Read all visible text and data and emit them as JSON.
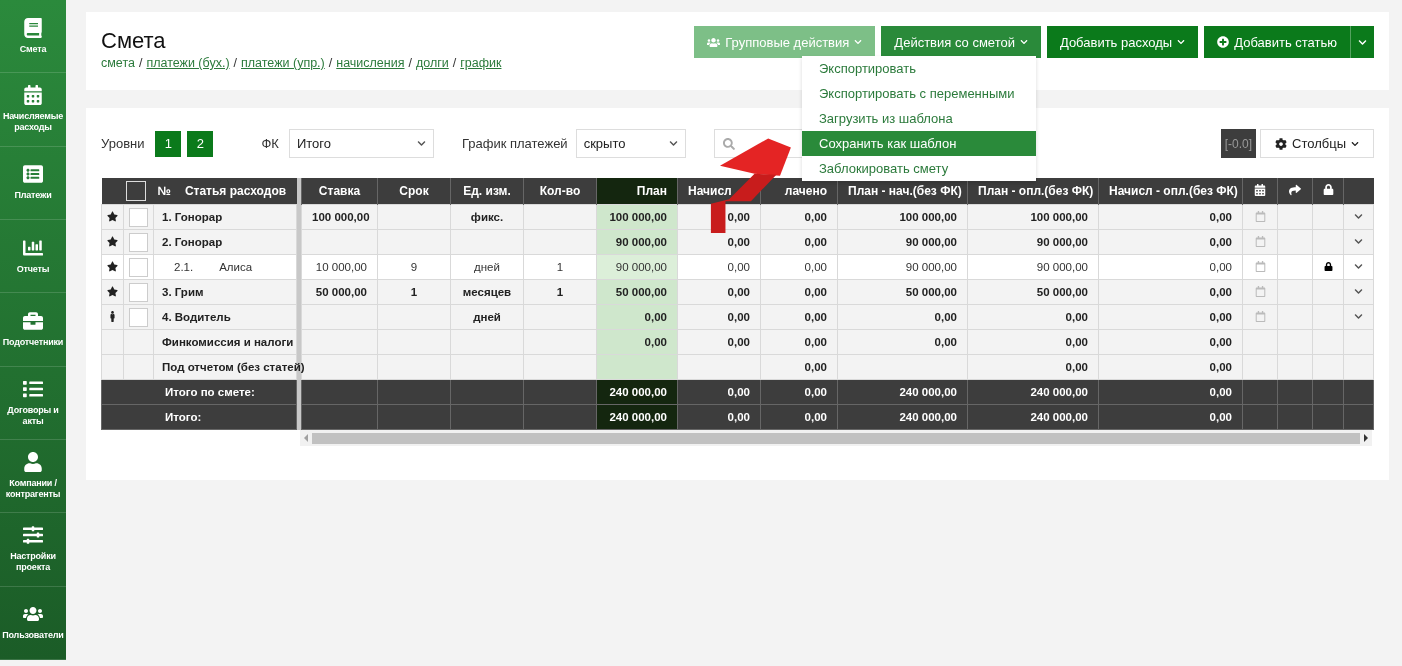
{
  "sidebar": {
    "items": [
      {
        "label": "Смета"
      },
      {
        "label": "Начисляемые расходы"
      },
      {
        "label": "Платежи"
      },
      {
        "label": "Отчеты"
      },
      {
        "label": "Подотчетники"
      },
      {
        "label": "Договоры и акты"
      },
      {
        "label": "Компании / контрагенты"
      },
      {
        "label": "Настройки проекта"
      },
      {
        "label": "Пользователи"
      }
    ]
  },
  "header": {
    "title": "Смета",
    "breadcrumbs": [
      {
        "label": "смета",
        "link": false
      },
      {
        "label": "платежи (бух.)",
        "link": true
      },
      {
        "label": "платежи (упр.)",
        "link": true
      },
      {
        "label": "начисления",
        "link": true
      },
      {
        "label": "долги",
        "link": true
      },
      {
        "label": "график",
        "link": true
      }
    ],
    "separator": "/"
  },
  "toolbar": [
    {
      "label": "Групповые действия",
      "kind": "group",
      "disabled": true
    },
    {
      "label": "Действия со сметой",
      "kind": "menu",
      "expanded": true
    },
    {
      "label": "Добавить расходы",
      "kind": "menu",
      "expanded": false
    },
    {
      "label": "Добавить статью",
      "kind": "split"
    }
  ],
  "menu": {
    "items": [
      {
        "label": "Экспортировать",
        "selected": false
      },
      {
        "label": "Экспортировать с переменными",
        "selected": false
      },
      {
        "label": "Загрузить из шаблона",
        "selected": false
      },
      {
        "label": "Сохранить как шаблон",
        "selected": true
      },
      {
        "label": "Заблокировать смету",
        "selected": false
      }
    ]
  },
  "filters": {
    "levels_label": "Уровни",
    "levels": [
      {
        "label": "1"
      },
      {
        "label": "2"
      }
    ],
    "fk": {
      "label": "ФК",
      "value": "Итого"
    },
    "schedule": {
      "label": "График платежей",
      "value": "скрыто"
    },
    "badge": "[-0.0]",
    "columns_button": "Столбцы"
  },
  "table": {
    "all_checked": false,
    "number_header": "№",
    "name_header": "Статья расходов",
    "columns": [
      "Ставка",
      "Срок",
      "Ед. изм.",
      "Кол-во",
      "План",
      "Начисл",
      "лачено",
      "План - нач.(без ФК)",
      "План - опл.(без ФК)",
      "Начисл - опл.(без ФК)"
    ],
    "rows": [
      {
        "kind": "star",
        "checked": false,
        "name": "1. Гонорар",
        "cells": [
          "100 000,00",
          "",
          "фикс.",
          "",
          "100 000,00",
          "0,00",
          "0,00",
          "100 000,00",
          "100 000,00",
          "0,00"
        ],
        "calendar": true,
        "locked": false,
        "expandable": true
      },
      {
        "kind": "star",
        "checked": false,
        "name": "2. Гонорар",
        "cells": [
          "",
          "",
          "",
          "",
          "90 000,00",
          "0,00",
          "0,00",
          "90 000,00",
          "90 000,00",
          "0,00"
        ],
        "calendar": true,
        "locked": false,
        "expandable": true,
        "children": [
          {
            "kind": "star",
            "checked": false,
            "number": "2.1.",
            "name": "Алиса",
            "cells": [
              "10 000,00",
              "9",
              "дней",
              "1",
              "90 000,00",
              "0,00",
              "0,00",
              "90 000,00",
              "90 000,00",
              "0,00"
            ],
            "calendar": true,
            "locked": true,
            "expandable": true
          }
        ]
      },
      {
        "kind": "star",
        "checked": false,
        "name": "3. Грим",
        "cells": [
          "50 000,00",
          "1",
          "месяцев",
          "1",
          "50 000,00",
          "0,00",
          "0,00",
          "50 000,00",
          "50 000,00",
          "0,00"
        ],
        "calendar": true,
        "locked": false,
        "expandable": true
      },
      {
        "kind": "person",
        "checked": false,
        "name": "4. Водитель",
        "cells": [
          "",
          "",
          "дней",
          "",
          "0,00",
          "0,00",
          "0,00",
          "0,00",
          "0,00",
          "0,00"
        ],
        "calendar": true,
        "locked": false,
        "expandable": true
      },
      {
        "kind": "plain",
        "name": "Финкомиссия и налоги",
        "cells": [
          "",
          "",
          "",
          "",
          "0,00",
          "0,00",
          "0,00",
          "0,00",
          "0,00",
          "0,00"
        ],
        "calendar": false,
        "locked": false,
        "expandable": false
      },
      {
        "kind": "plain",
        "name": "Под отчетом (без статей)",
        "cells": [
          "",
          "",
          "",
          "",
          "",
          "",
          "0,00",
          "",
          "0,00",
          "0,00"
        ],
        "calendar": false,
        "locked": false,
        "expandable": false
      }
    ],
    "totals": [
      {
        "label": "Итого по смете:",
        "cells": [
          "",
          "",
          "",
          "",
          "240 000,00",
          "0,00",
          "0,00",
          "240 000,00",
          "240 000,00",
          "0,00"
        ]
      },
      {
        "label": "Итого:",
        "cells": [
          "",
          "",
          "",
          "",
          "240 000,00",
          "0,00",
          "0,00",
          "240 000,00",
          "240 000,00",
          "0,00"
        ]
      }
    ]
  }
}
